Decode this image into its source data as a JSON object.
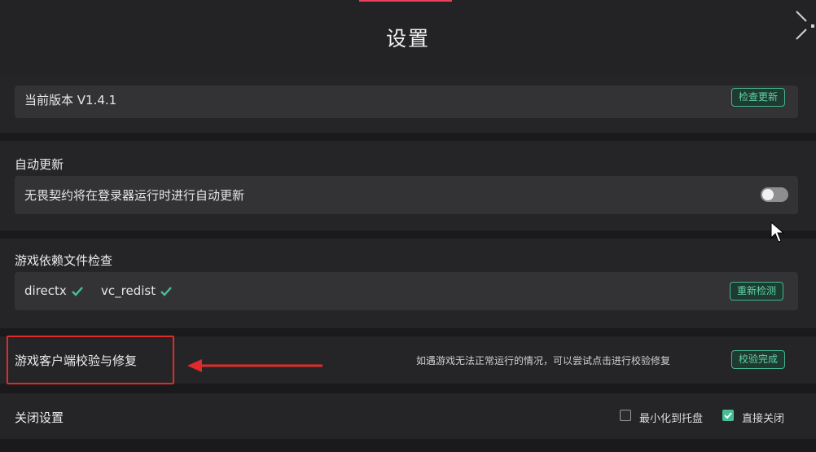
{
  "window": {
    "title": "设置"
  },
  "version": {
    "label": "当前版本 V1.4.1",
    "button": "检查更新"
  },
  "auto_update": {
    "title": "自动更新",
    "description": "无畏契约将在登录器运行时进行自动更新",
    "enabled": false
  },
  "dependencies": {
    "title": "游戏依赖文件检查",
    "items": [
      "directx",
      "vc_redist"
    ],
    "button": "重新检测"
  },
  "repair": {
    "title": "游戏客户端校验与修复",
    "hint": "如遇游戏无法正常运行的情况，可以尝试点击进行校验修复",
    "button": "校验完成"
  },
  "close_settings": {
    "title": "关闭设置",
    "options": [
      {
        "label": "最小化到托盘",
        "checked": false
      },
      {
        "label": "直接关闭",
        "checked": true
      }
    ]
  },
  "colors": {
    "accent": "#47bf95",
    "annotation": "#e12a2a",
    "top_accent": "#e8435a"
  }
}
